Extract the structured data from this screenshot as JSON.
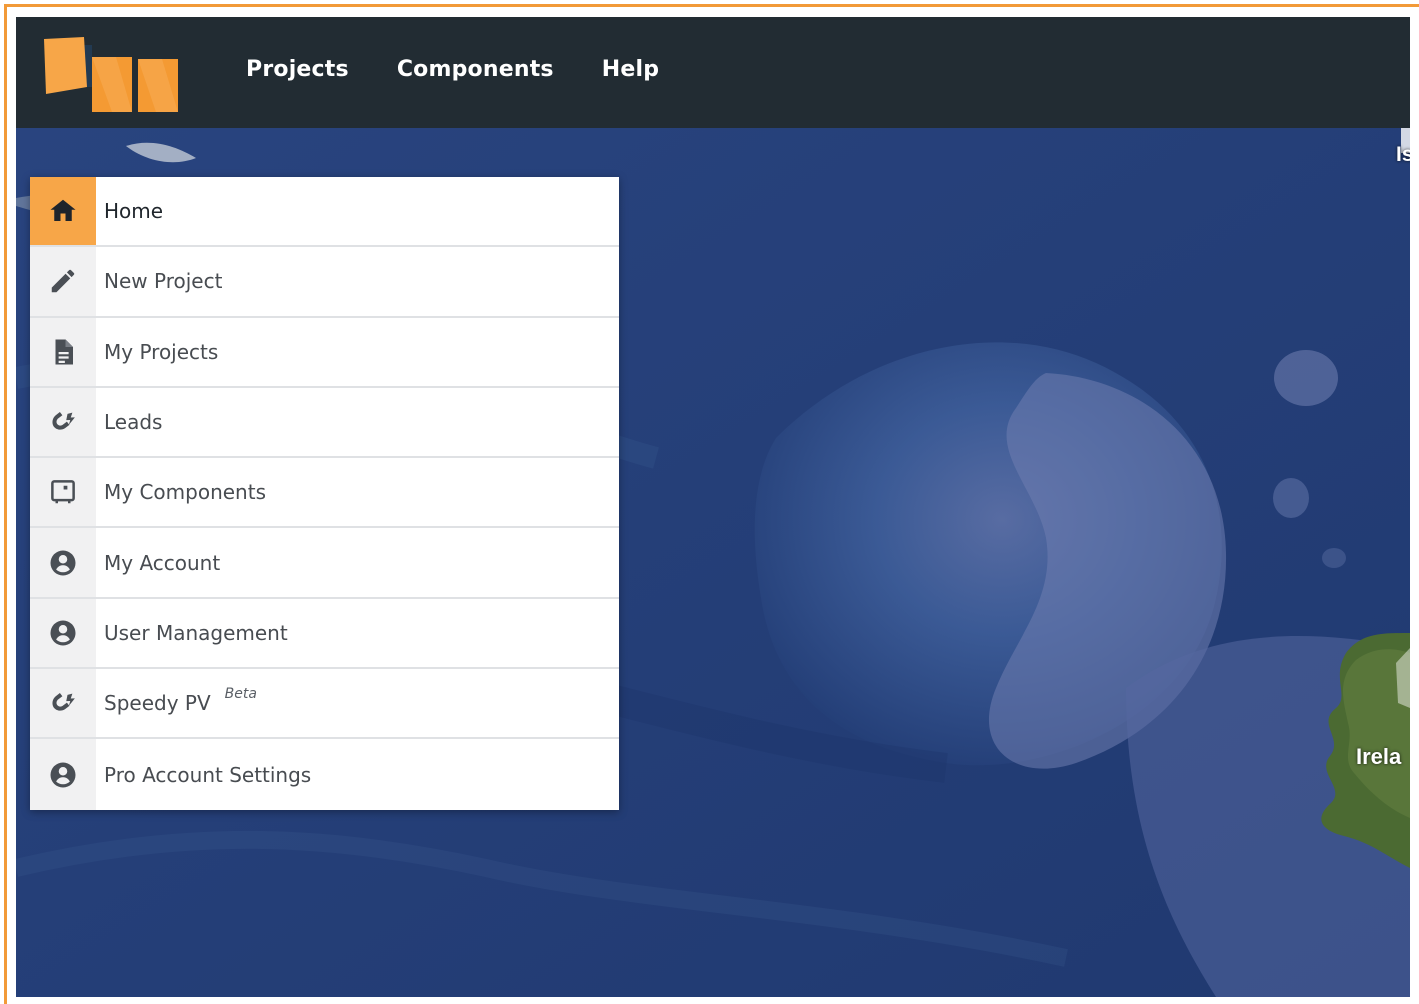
{
  "topbar": {
    "logo": "solar-panel-logo",
    "nav": [
      {
        "label": "Projects"
      },
      {
        "label": "Components"
      },
      {
        "label": "Help"
      }
    ]
  },
  "map": {
    "labels": {
      "top_right": "Is",
      "ireland": "Irela"
    },
    "ocean_color": "#2c477c",
    "land_color": "#4b6a32"
  },
  "menu": {
    "items": [
      {
        "label": "Home",
        "icon": "home-icon",
        "active": true
      },
      {
        "label": "New Project",
        "icon": "pencil-icon"
      },
      {
        "label": "My Projects",
        "icon": "document-icon"
      },
      {
        "label": "Leads",
        "icon": "magnet-icon"
      },
      {
        "label": "My Components",
        "icon": "component-icon"
      },
      {
        "label": "My Account",
        "icon": "user-icon"
      },
      {
        "label": "User Management",
        "icon": "user-icon"
      },
      {
        "label": "Speedy PV",
        "icon": "magnet-icon",
        "badge": "Beta"
      },
      {
        "label": "Pro Account Settings",
        "icon": "user-icon"
      }
    ]
  },
  "colors": {
    "accent": "#f7a648",
    "topbar": "#222c33",
    "frame": "#f29a38"
  }
}
